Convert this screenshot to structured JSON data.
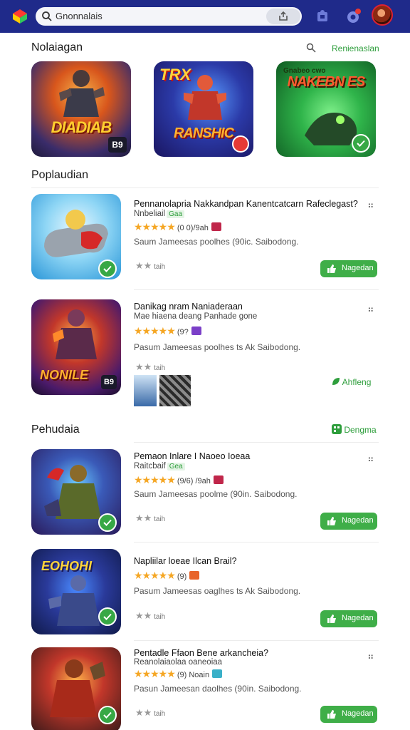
{
  "search": {
    "query": "Gnonnalais"
  },
  "sections": {
    "featured": {
      "title": "Nolaiagan",
      "link": "Renienaslan"
    },
    "popular": {
      "title": "Poplaudian"
    },
    "publications": {
      "title": "Pehudaia",
      "link": "Dengma"
    }
  },
  "featured": [
    {
      "title": "DIADIAB",
      "badge": "B9"
    },
    {
      "title_top": "TRX",
      "title": "RANSHIC"
    },
    {
      "title_top": "Gnabeo cwo",
      "title": "NAKEBN ES"
    }
  ],
  "items": [
    {
      "title": "Pennanolapria Nakkandpan Kanentcatcarn Rafeclegast?",
      "sub": "Nnbeliail",
      "sub_badge": "Gaa",
      "stars": "★★★★★",
      "rating": "(0 0)/9ah",
      "tag_color": "#c0264a",
      "desc": "Saum Jameesas poolhes (90ic. Saibodong.",
      "mini": "taih",
      "action": "Nagedan"
    },
    {
      "title": "Danikag nram Naniaderaan",
      "sub": "Mae hiaena deang Panhade gone",
      "stars": "★★★★★",
      "rating": "(9?",
      "tag_color": "#7b3fc8",
      "desc": "Pasum Jameesas poolhes ts Ak Saibodong.",
      "mini": "taih",
      "action": "Ahfleng",
      "thumb_label": "B9"
    },
    {
      "title": "Pemaon Inlare I Naoeo Ioeaa",
      "sub": "Raitcbaif",
      "sub_badge": "Gea",
      "stars": "★★★★★",
      "rating": "(9/6) /9ah",
      "tag_color": "#c0264a",
      "desc": "Saum Jameesas poolme (90in. Saibodong.",
      "mini": "taih",
      "action": "Nagedan"
    },
    {
      "title": "Napliilar loeae Ilcan Brail?",
      "stars": "★★★★★",
      "rating": "(9)",
      "tag_color": "#e8642a",
      "desc": "Pasum Jameesas oaglhes ts Ak Saibodong.",
      "mini": "taih",
      "action": "Nagedan",
      "thumb_label": "EOHOHI"
    },
    {
      "title": "Pentadle Ffaon Bene arkancheia?",
      "sub": "Reanolaiaolaa oaneoiaa",
      "stars": "★★★★★",
      "rating": "(9) Noain",
      "tag_color": "#3ab0c8",
      "desc": "Pasun Jameesan daolhes (90in. Saibodong.",
      "mini": "taih",
      "action": "Nagedan"
    }
  ],
  "colors": {
    "topbar": "#1f2a8a",
    "accent_green": "#3fae48",
    "star": "#f5a623"
  }
}
